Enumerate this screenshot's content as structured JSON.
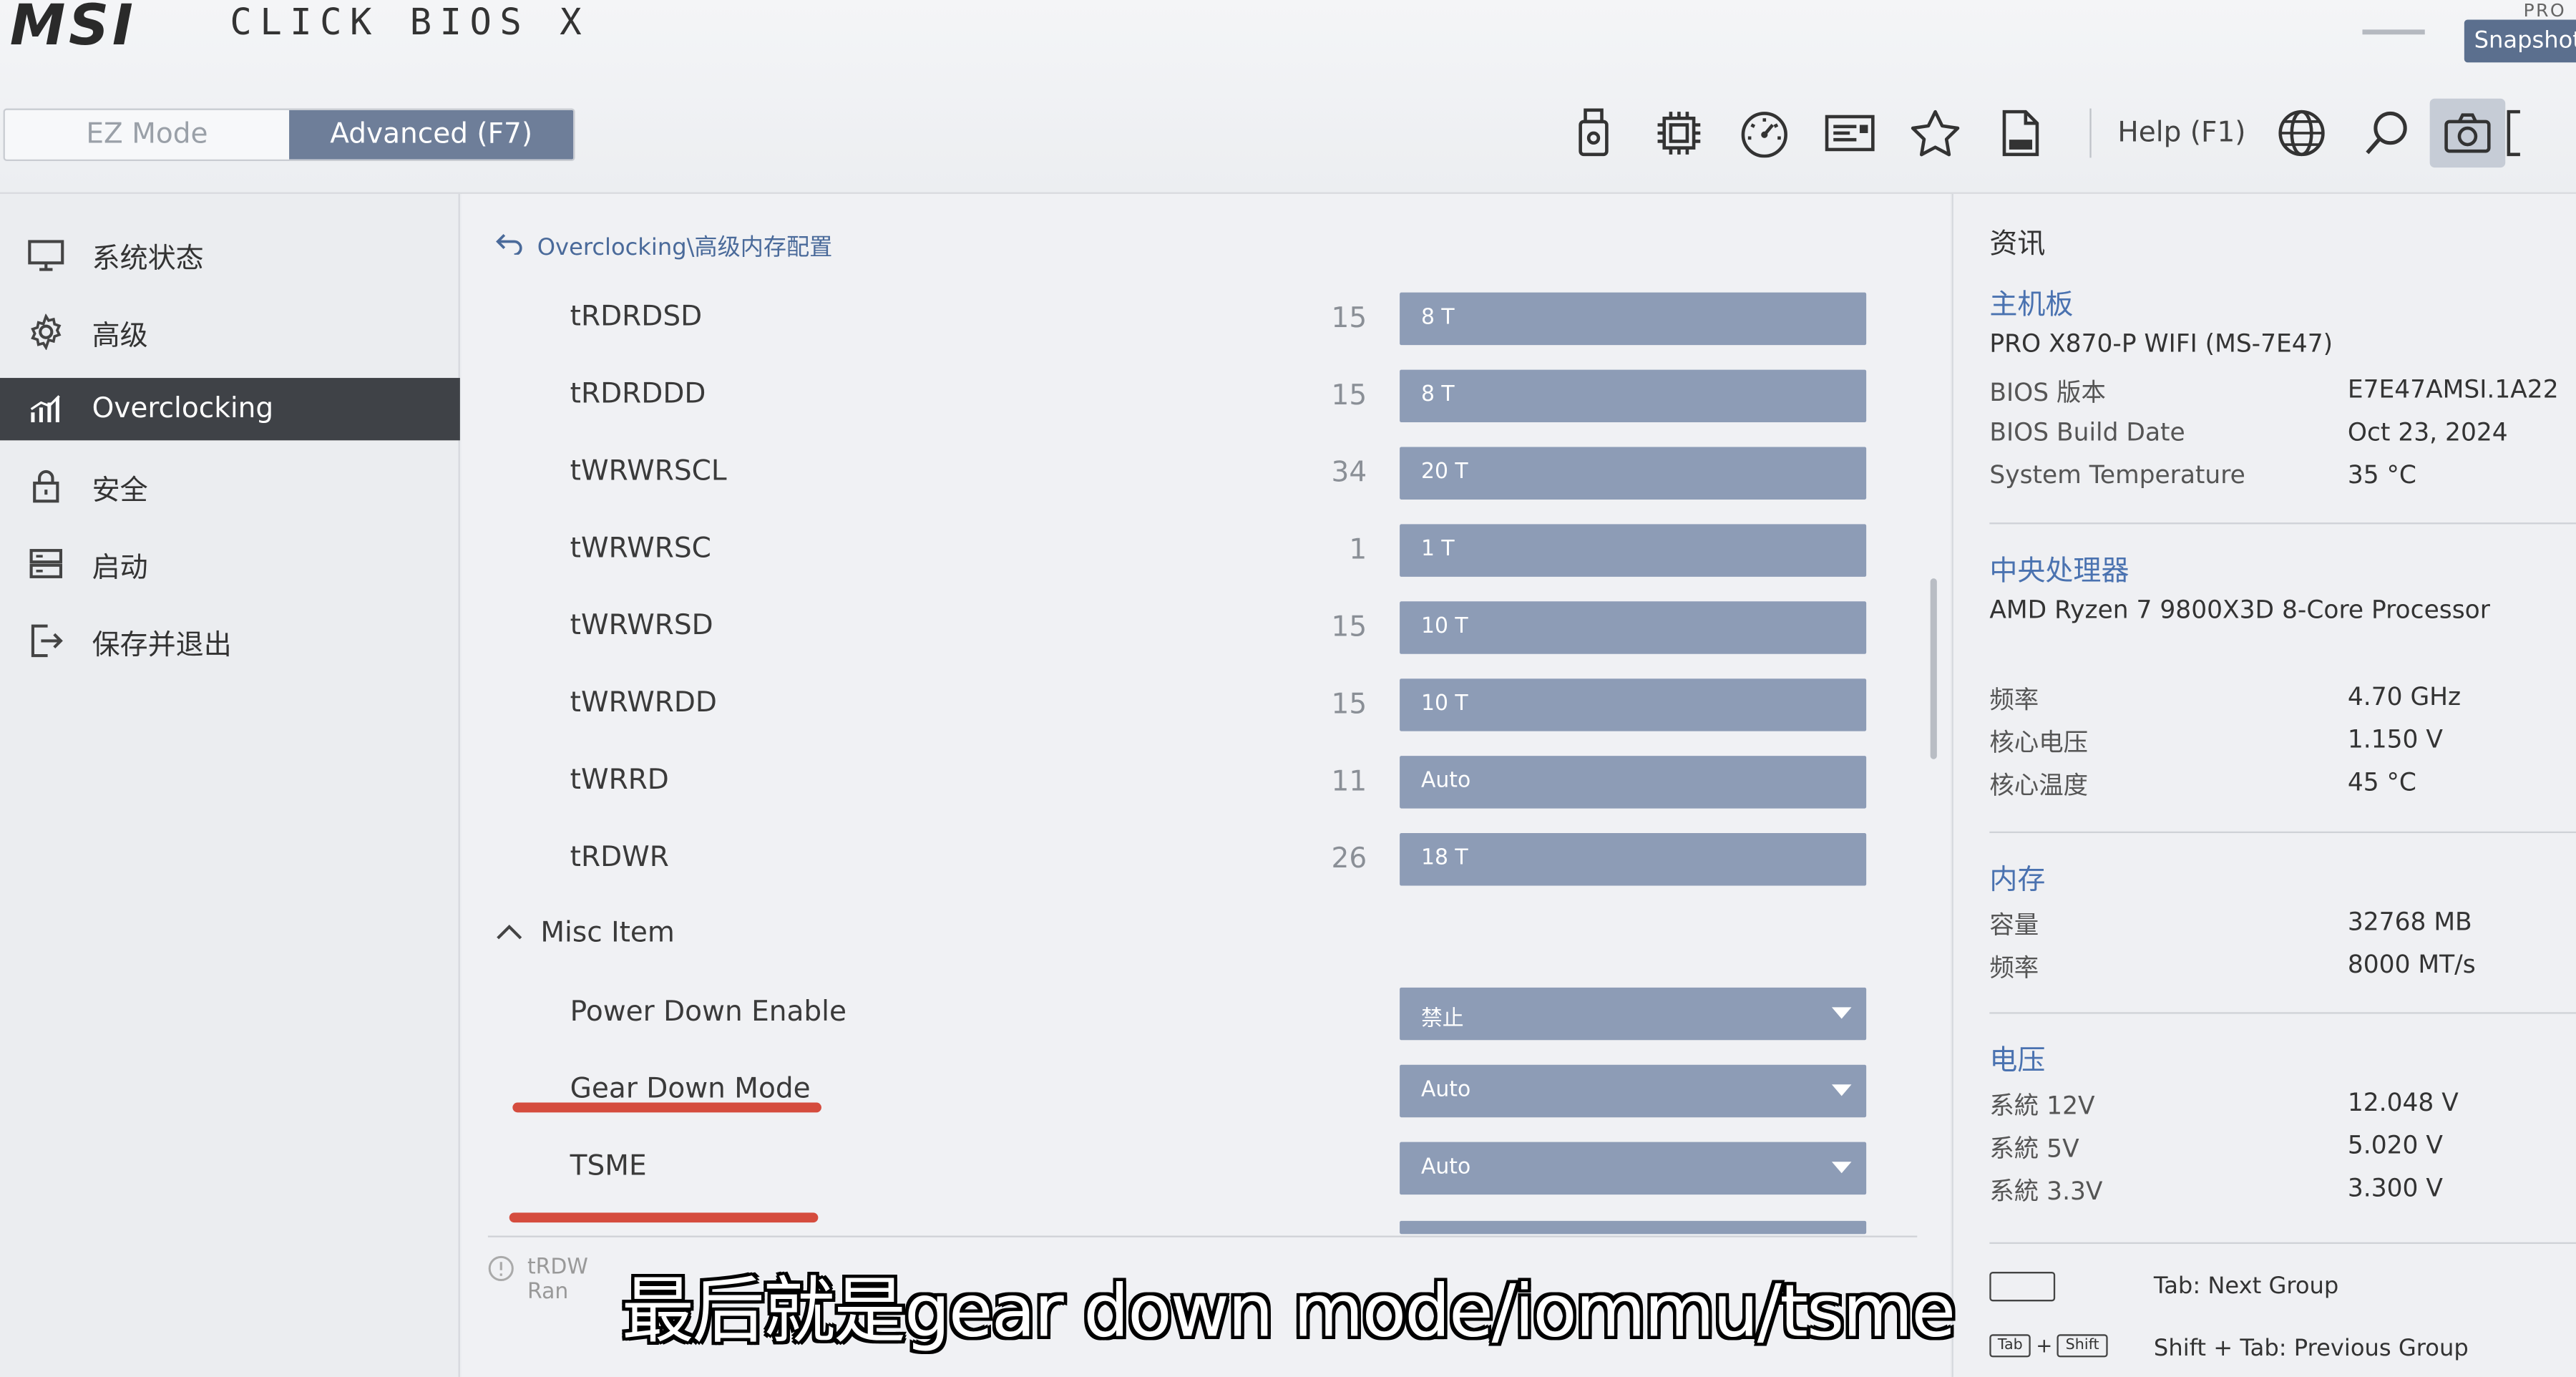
{
  "app": {
    "brand": "MSI",
    "product": "CLICK BIOS X",
    "corner_label": "PRO"
  },
  "modes": {
    "ez": "EZ Mode",
    "advanced": "Advanced (F7)"
  },
  "toolbar": {
    "icons": [
      "usb-flash-icon",
      "cpu-icon",
      "gauge-icon",
      "id-card-icon",
      "favorite-star-icon",
      "log-file-icon"
    ],
    "help_label": "Help (F1)",
    "snapshot_tooltip": "Snapshot"
  },
  "sidebar": {
    "items": [
      {
        "label": "系统状态",
        "icon": "monitor-icon",
        "active": false
      },
      {
        "label": "高级",
        "icon": "gear-icon",
        "active": false
      },
      {
        "label": "Overclocking",
        "icon": "bar-chart-icon",
        "active": true
      },
      {
        "label": "安全",
        "icon": "lock-icon",
        "active": false
      },
      {
        "label": "启动",
        "icon": "boot-drive-icon",
        "active": false
      },
      {
        "label": "保存并退出",
        "icon": "exit-icon",
        "active": false
      }
    ]
  },
  "main": {
    "breadcrumb": "Overclocking\\高级内存配置",
    "rows": [
      {
        "label": "tRDRDSD",
        "current": "15",
        "setting": "8 T"
      },
      {
        "label": "tRDRDDD",
        "current": "15",
        "setting": "8 T"
      },
      {
        "label": "tWRWRSCL",
        "current": "34",
        "setting": "20 T"
      },
      {
        "label": "tWRWRSC",
        "current": "1",
        "setting": "1 T"
      },
      {
        "label": "tWRWRSD",
        "current": "15",
        "setting": "10 T"
      },
      {
        "label": "tWRWRDD",
        "current": "15",
        "setting": "10 T"
      },
      {
        "label": "tWRRD",
        "current": "11",
        "setting": "Auto"
      },
      {
        "label": "tRDWR",
        "current": "26",
        "setting": "18 T"
      }
    ],
    "misc_header": "Misc Item",
    "misc_rows": [
      {
        "label": "Power Down Enable",
        "setting": "禁止"
      },
      {
        "label": "Gear Down Mode",
        "setting": "Auto"
      },
      {
        "label": "TSME",
        "setting": "Auto"
      }
    ],
    "info_text": "tRDW",
    "info_text2": "Ran"
  },
  "info_panel": {
    "title": "资讯",
    "motherboard_header": "主机板",
    "motherboard_model": "PRO X870-P WIFI (MS-7E47)",
    "mb_rows": [
      {
        "k": "BIOS 版本",
        "v": "E7E47AMSI.1A22"
      },
      {
        "k": "BIOS Build Date",
        "v": "Oct 23, 2024"
      },
      {
        "k": "System Temperature",
        "v": "35 °C"
      }
    ],
    "cpu_header": "中央处理器",
    "cpu_model": "AMD Ryzen 7 9800X3D 8-Core Processor",
    "cpu_rows": [
      {
        "k": "频率",
        "v": "4.70 GHz"
      },
      {
        "k": "核心电压",
        "v": "1.150 V"
      },
      {
        "k": "核心温度",
        "v": "45 °C"
      }
    ],
    "mem_header": "内存",
    "mem_rows": [
      {
        "k": "容量",
        "v": "32768 MB"
      },
      {
        "k": "频率",
        "v": "8000 MT/s"
      }
    ],
    "volt_header": "电压",
    "volt_rows": [
      {
        "k": "系統 12V",
        "v": "12.048 V"
      },
      {
        "k": "系統 5V",
        "v": "5.020 V"
      },
      {
        "k": "系統 3.3V",
        "v": "3.300 V"
      }
    ],
    "hints": [
      {
        "keys": "",
        "text": "Tab: Next Group"
      },
      {
        "keys": "Tab + Shift",
        "text": "Shift + Tab: Previous Group"
      }
    ],
    "keycaps": {
      "tab": "Tab",
      "plus": "+",
      "shift": "Shift"
    }
  },
  "subtitle": "最后就是gear down mode/iommu/tsme",
  "colors": {
    "accent": "#6e7e99",
    "field": "#8d9cb6",
    "annotation_red": "#d23a2a",
    "section_blue": "#4a72b0"
  }
}
